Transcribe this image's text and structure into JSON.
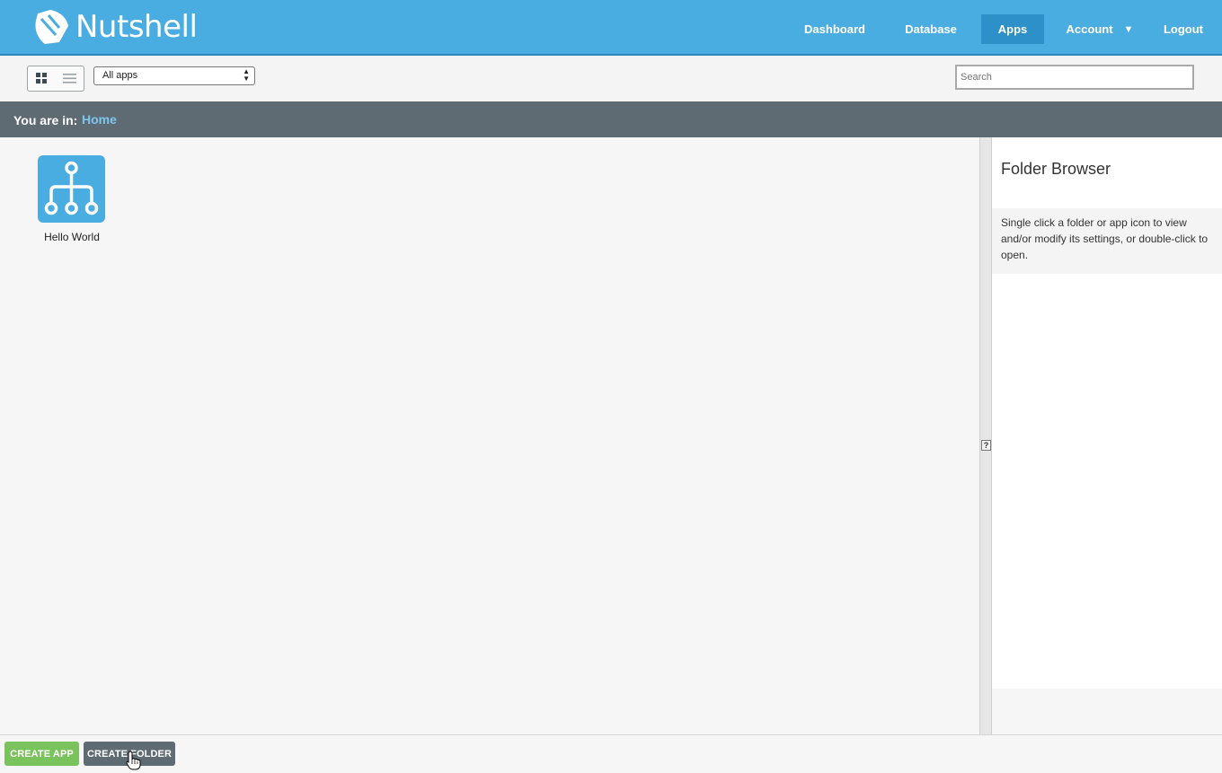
{
  "brand": {
    "name": "Nutshell"
  },
  "nav": {
    "dashboard": "Dashboard",
    "database": "Database",
    "apps": "Apps",
    "account": "Account",
    "account_caret": "▼",
    "logout": "Logout"
  },
  "toolbar": {
    "filter_selected": "All apps",
    "search_placeholder": "Search"
  },
  "breadcrumb": {
    "label": "You are in:",
    "home": "Home"
  },
  "apps": [
    {
      "name": "Hello World"
    }
  ],
  "side_panel": {
    "title": "Folder Browser",
    "info": "Single click a folder or app icon to view and/or modify its settings, or double-click to open."
  },
  "help_glyph": "?",
  "footer": {
    "create_app": "CREATE APP",
    "create_folder": "CREATE FOLDER"
  },
  "colors": {
    "header": "#4aade1",
    "nav_active": "#2e90c8",
    "breadcrumb_bar": "#5f6b72",
    "breadcrumb_link": "#7ec6ee",
    "create_app": "#7ac25c",
    "create_folder": "#5f6b72"
  }
}
